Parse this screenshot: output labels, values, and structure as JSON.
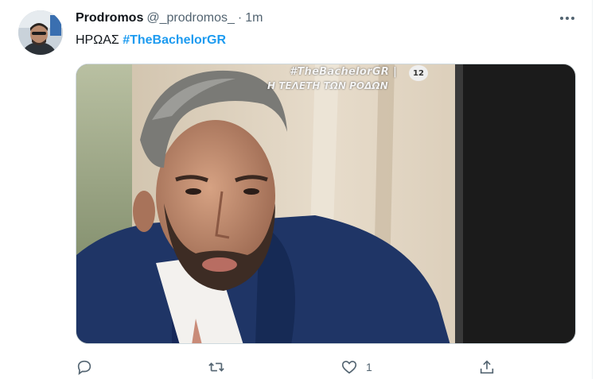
{
  "tweet": {
    "author": {
      "display_name": "Prodromos",
      "handle": "@_prodromos_",
      "separator": "·",
      "time": "1m"
    },
    "text": {
      "word": "ΗΡΩΑΣ",
      "hashtag": "#TheBachelorGR"
    },
    "media": {
      "overlay_hashtag": "#TheBachelorGR |",
      "overlay_caption": "Η ΤΕΛΕΤΗ ΤΩΝ ΡΟΔΩΝ",
      "channel_badge": "12"
    },
    "actions": {
      "reply_count": "",
      "retweet_count": "",
      "like_count": "1"
    },
    "icons": [
      "avatar",
      "more-icon",
      "reply-icon",
      "retweet-icon",
      "like-icon",
      "share-icon"
    ],
    "colors": {
      "link": "#1d9bf0",
      "secondary_text": "#536471",
      "primary_text": "#0f1419"
    }
  }
}
